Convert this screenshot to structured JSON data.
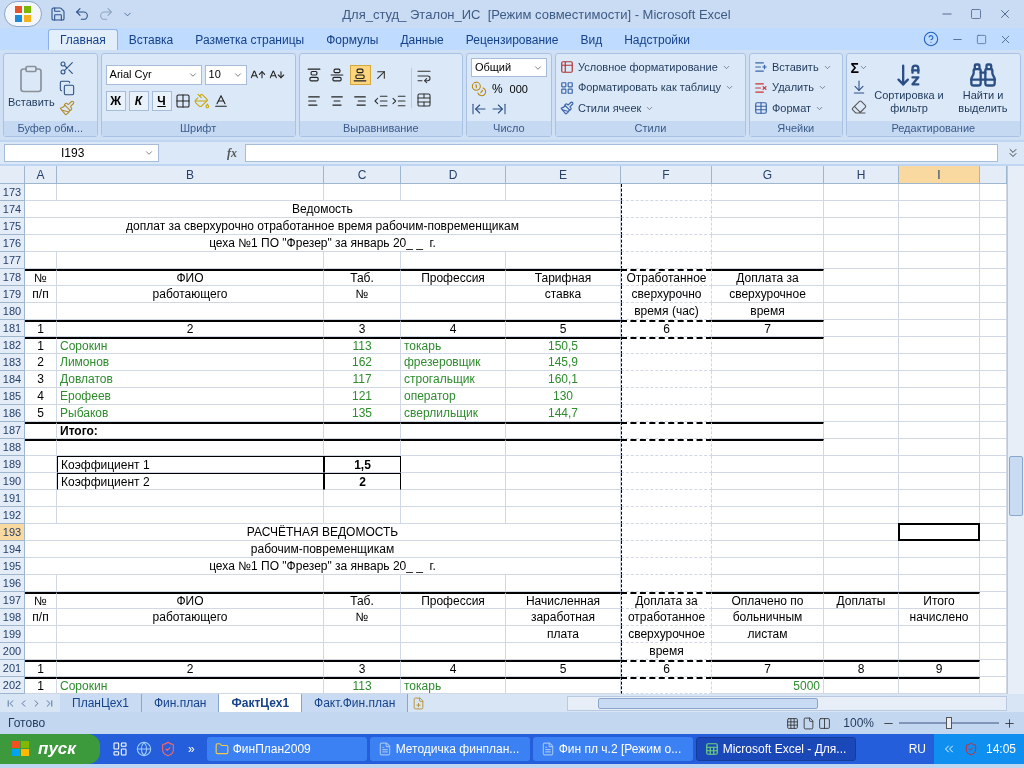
{
  "window": {
    "title": "Для_студ_ Эталон_ИС  [Режим совместимости] - Microsoft Excel"
  },
  "ribbon_tabs": [
    {
      "label": "Главная",
      "selected": true
    },
    {
      "label": "Вставка",
      "selected": false
    },
    {
      "label": "Разметка страницы",
      "selected": false
    },
    {
      "label": "Формулы",
      "selected": false
    },
    {
      "label": "Данные",
      "selected": false
    },
    {
      "label": "Рецензирование",
      "selected": false
    },
    {
      "label": "Вид",
      "selected": false
    },
    {
      "label": "Надстройки",
      "selected": false
    }
  ],
  "clipboard": {
    "paste": "Вставить",
    "label": "Буфер обм..."
  },
  "font": {
    "name": "Arial Cyr",
    "size": "10",
    "bold": "Ж",
    "italic": "К",
    "underline": "Ч",
    "label": "Шрифт"
  },
  "alignment": {
    "buttons": [
      {
        "kind": "top",
        "selected": false
      },
      {
        "kind": "middle",
        "selected": false
      },
      {
        "kind": "bottom",
        "selected": true
      },
      {
        "kind": "left",
        "selected": false
      },
      {
        "kind": "center",
        "selected": false
      },
      {
        "kind": "right",
        "selected": false
      }
    ],
    "label": "Выравнивание"
  },
  "number": {
    "format": "Общий",
    "percent": "%",
    "thousands": "000",
    "label": "Число"
  },
  "styles": {
    "items": [
      "Условное форматирование",
      "Форматировать как таблицу",
      "Стили ячеек"
    ],
    "label": "Стили"
  },
  "cells_group": {
    "items": [
      "Вставить",
      "Удалить",
      "Формат"
    ],
    "label": "Ячейки"
  },
  "editing": {
    "sum": "Σ",
    "sort": "Сортировка и фильтр",
    "find": "Найти и выделить",
    "label": "Редактирование"
  },
  "formula_bar": {
    "name_box": "I193",
    "fx": "fx"
  },
  "sheet": {
    "columns": [
      {
        "label": "A",
        "selected": false
      },
      {
        "label": "B",
        "selected": false
      },
      {
        "label": "C",
        "selected": false
      },
      {
        "label": "D",
        "selected": false
      },
      {
        "label": "E",
        "selected": false
      },
      {
        "label": "F",
        "selected": false
      },
      {
        "label": "G",
        "selected": false
      },
      {
        "label": "H",
        "selected": false
      },
      {
        "label": "I",
        "selected": true
      }
    ],
    "rows": [
      {
        "number": "173",
        "selected": false
      },
      {
        "number": "174",
        "selected": false,
        "kind": "title",
        "text": "Ведомость"
      },
      {
        "number": "175",
        "selected": false,
        "kind": "title",
        "text": "доплат за сверхурочно отработанное время рабочим-повременщикам"
      },
      {
        "number": "176",
        "selected": false,
        "kind": "title",
        "text": "цеха №1 ПО \"Фрезер\" за январь 20_ _  г."
      },
      {
        "number": "177",
        "selected": false
      },
      {
        "number": "178",
        "selected": false,
        "cells": [
          {
            "text": "№",
            "kind": "centered",
            "rule_above": true
          },
          {
            "text": "ФИО",
            "kind": "centered",
            "rule_above": true
          },
          {
            "text": "Таб.",
            "kind": "centered",
            "rule_above": true
          },
          {
            "text": "Профессия",
            "kind": "centered",
            "rule_above": true
          },
          {
            "text": "Тарифная",
            "kind": "centered",
            "rule_above": true
          },
          {
            "text": "Отработанное",
            "kind": "centered",
            "rule_above": true
          },
          {
            "text": "Доплата за",
            "kind": "centered",
            "rule_above": true
          }
        ]
      },
      {
        "number": "179",
        "selected": false,
        "cells": [
          {
            "text": "п/п",
            "kind": "centered"
          },
          {
            "text": "работающего",
            "kind": "centered"
          },
          {
            "text": "№",
            "kind": "centered"
          },
          null,
          {
            "text": "ставка",
            "kind": "centered"
          },
          {
            "text": "сверхурочно",
            "kind": "centered"
          },
          {
            "text": "сверхурочное",
            "kind": "centered"
          }
        ]
      },
      {
        "number": "180",
        "selected": false,
        "cells": [
          null,
          null,
          null,
          null,
          null,
          {
            "text": "время (час)",
            "kind": "centered"
          },
          {
            "text": "время",
            "kind": "centered"
          }
        ]
      },
      {
        "number": "181",
        "selected": false,
        "cells": [
          {
            "text": "1",
            "kind": "centered",
            "rule_above": true
          },
          {
            "text": "2",
            "kind": "centered",
            "rule_above": true
          },
          {
            "text": "3",
            "kind": "centered",
            "rule_above": true
          },
          {
            "text": "4",
            "kind": "centered",
            "rule_above": true
          },
          {
            "text": "5",
            "kind": "centered",
            "rule_above": true
          },
          {
            "text": "6",
            "kind": "centered",
            "rule_above": true
          },
          {
            "text": "7",
            "kind": "centered",
            "rule_above": true
          }
        ]
      },
      {
        "number": "182",
        "selected": false,
        "cells": [
          {
            "text": "1",
            "kind": "centered",
            "rule_above": true
          },
          {
            "text": "Сорокин",
            "kind": "left",
            "color": "#2e8b2e",
            "rule_above": true
          },
          {
            "text": "113",
            "kind": "centered",
            "color": "#2e8b2e",
            "rule_above": true
          },
          {
            "text": "токарь",
            "kind": "left",
            "color": "#2e8b2e",
            "rule_above": true
          },
          {
            "text": "150,5",
            "kind": "centered",
            "color": "#2e8b2e",
            "rule_above": true
          },
          {
            "rule_above": true
          },
          {
            "rule_above": true
          }
        ]
      },
      {
        "number": "183",
        "selected": false,
        "cells": [
          {
            "text": "2",
            "kind": "centered"
          },
          {
            "text": "Лимонов",
            "kind": "left",
            "color": "#2e8b2e"
          },
          {
            "text": "162",
            "kind": "centered",
            "color": "#2e8b2e"
          },
          {
            "text": "фрезеровщик",
            "kind": "left",
            "color": "#2e8b2e"
          },
          {
            "text": "145,9",
            "kind": "centered",
            "color": "#2e8b2e"
          }
        ]
      },
      {
        "number": "184",
        "selected": false,
        "cells": [
          {
            "text": "3",
            "kind": "centered"
          },
          {
            "text": "Довлатов",
            "kind": "left",
            "color": "#2e8b2e"
          },
          {
            "text": "117",
            "kind": "centered",
            "color": "#2e8b2e"
          },
          {
            "text": "строгальщик",
            "kind": "left",
            "color": "#2e8b2e"
          },
          {
            "text": "160,1",
            "kind": "centered",
            "color": "#2e8b2e"
          }
        ]
      },
      {
        "number": "185",
        "selected": false,
        "cells": [
          {
            "text": "4",
            "kind": "centered"
          },
          {
            "text": "Ерофеев",
            "kind": "left",
            "color": "#2e8b2e"
          },
          {
            "text": "121",
            "kind": "centered",
            "color": "#2e8b2e"
          },
          {
            "text": "оператор",
            "kind": "left",
            "color": "#2e8b2e"
          },
          {
            "text": "130",
            "kind": "centered",
            "color": "#2e8b2e"
          }
        ]
      },
      {
        "number": "186",
        "selected": false,
        "cells": [
          {
            "text": "5",
            "kind": "centered"
          },
          {
            "text": "Рыбаков",
            "kind": "left",
            "color": "#2e8b2e"
          },
          {
            "text": "135",
            "kind": "centered",
            "color": "#2e8b2e"
          },
          {
            "text": "сверлильщик",
            "kind": "left",
            "color": "#2e8b2e"
          },
          {
            "text": "144,7",
            "kind": "centered",
            "color": "#2e8b2e"
          }
        ]
      },
      {
        "number": "187",
        "selected": false,
        "cells": [
          {
            "rule_above": true
          },
          {
            "text": "Итого:",
            "kind": "left",
            "bold": true,
            "rule_above": true
          },
          {
            "rule_above": true
          },
          {
            "rule_above": true
          },
          {
            "rule_above": true
          },
          {
            "rule_above": true
          },
          {
            "rule_above": true
          }
        ]
      },
      {
        "number": "188",
        "selected": false,
        "cells": [
          {
            "rule_above": true
          },
          {
            "rule_above": true
          },
          {
            "rule_above": true
          },
          {
            "rule_above": true
          },
          {
            "rule_above": true
          },
          {
            "rule_above": true
          },
          {
            "rule_above": true
          }
        ]
      },
      {
        "number": "189",
        "selected": false,
        "cells": [
          null,
          {
            "text": "Коэффициент 1",
            "kind": "left",
            "boxed": true
          },
          {
            "text": "1,5",
            "kind": "centered",
            "bold": true,
            "boxed": true
          }
        ]
      },
      {
        "number": "190",
        "selected": false,
        "cells": [
          null,
          {
            "text": "Коэффициент 2",
            "kind": "left",
            "boxed": true
          },
          {
            "text": "2",
            "kind": "centered",
            "bold": true,
            "boxed": true
          }
        ]
      },
      {
        "number": "191",
        "selected": false
      },
      {
        "number": "192",
        "selected": false
      },
      {
        "number": "193",
        "selected": true,
        "kind": "title",
        "text": "РАСЧЁТНАЯ ВЕДОМОСТЬ"
      },
      {
        "number": "194",
        "selected": false,
        "kind": "title",
        "text": "рабочим-повременщикам"
      },
      {
        "number": "195",
        "selected": false,
        "kind": "title",
        "text": "цеха №1 ПО \"Фрезер\" за январь 20_ _  г."
      },
      {
        "number": "196",
        "selected": false
      },
      {
        "number": "197",
        "selected": false,
        "cells": [
          {
            "text": "№",
            "kind": "centered",
            "rule_above": true
          },
          {
            "text": "ФИО",
            "kind": "centered",
            "rule_above": true
          },
          {
            "text": "Таб.",
            "kind": "centered",
            "rule_above": true
          },
          {
            "text": "Профессия",
            "kind": "centered",
            "rule_above": true
          },
          {
            "text": "Начисленная",
            "kind": "centered",
            "rule_above": true
          },
          {
            "text": "Доплата за",
            "kind": "centered",
            "rule_above": true
          },
          {
            "text": "Оплачено по",
            "kind": "centered",
            "rule_above": true
          },
          {
            "text": "Доплаты",
            "kind": "centered",
            "rule_above": true
          },
          {
            "text": "Итого",
            "kind": "centered",
            "rule_above": true
          }
        ]
      },
      {
        "number": "198",
        "selected": false,
        "cells": [
          {
            "text": "п/п",
            "kind": "centered"
          },
          {
            "text": "работающего",
            "kind": "centered"
          },
          {
            "text": "№",
            "kind": "centered"
          },
          null,
          {
            "text": "заработная",
            "kind": "centered"
          },
          {
            "text": "отработанное",
            "kind": "centered"
          },
          {
            "text": "больничным",
            "kind": "centered"
          },
          null,
          {
            "text": "начислено",
            "kind": "centered"
          }
        ]
      },
      {
        "number": "199",
        "selected": false,
        "cells": [
          null,
          null,
          null,
          null,
          {
            "text": "плата",
            "kind": "centered"
          },
          {
            "text": "сверхурочное",
            "kind": "centered"
          },
          {
            "text": "листам",
            "kind": "centered"
          }
        ]
      },
      {
        "number": "200",
        "selected": false,
        "cells": [
          null,
          null,
          null,
          null,
          null,
          {
            "text": "время",
            "kind": "centered"
          }
        ]
      },
      {
        "number": "201",
        "selected": false,
        "cells": [
          {
            "text": "1",
            "kind": "centered",
            "rule_above": true
          },
          {
            "text": "2",
            "kind": "centered",
            "rule_above": true
          },
          {
            "text": "3",
            "kind": "centered",
            "rule_above": true
          },
          {
            "text": "4",
            "kind": "centered",
            "rule_above": true
          },
          {
            "text": "5",
            "kind": "centered",
            "rule_above": true
          },
          {
            "text": "6",
            "kind": "centered",
            "rule_above": true
          },
          {
            "text": "7",
            "kind": "centered",
            "rule_above": true
          },
          {
            "text": "8",
            "kind": "centered",
            "rule_above": true
          },
          {
            "text": "9",
            "kind": "centered",
            "rule_above": true
          }
        ]
      },
      {
        "number": "202",
        "selected": false,
        "cells": [
          {
            "text": "1",
            "kind": "centered",
            "rule_above": true
          },
          {
            "text": "Сорокин",
            "kind": "left",
            "color": "#2e8b2e",
            "rule_above": true
          },
          {
            "text": "113",
            "kind": "centered",
            "color": "#2e8b2e",
            "rule_above": true
          },
          {
            "text": "токарь",
            "kind": "left",
            "color": "#2e8b2e",
            "rule_above": true
          },
          {
            "rule_above": true
          },
          {
            "rule_above": true
          },
          {
            "text": "5000",
            "kind": "right",
            "color": "#2e8b2e",
            "rule_above": true
          },
          {
            "rule_above": true
          },
          {
            "rule_above": true
          }
        ]
      }
    ]
  },
  "sheet_tabs": [
    {
      "label": "ПланЦех1",
      "selected": false
    },
    {
      "label": "Фин.план",
      "selected": false
    },
    {
      "label": "ФактЦех1",
      "selected": true
    },
    {
      "label": "Факт.Фин.план",
      "selected": false
    }
  ],
  "status_bar": {
    "text": "Готово",
    "zoom": "100%",
    "zoom_slider": {
      "level": 0.5
    }
  },
  "taskbar": {
    "start": "пуск",
    "more": "»",
    "items": [
      {
        "label": "ФинПлан2009",
        "kind": "folder",
        "selected": false
      },
      {
        "label": "Методичка финплан...",
        "kind": "word",
        "selected": false
      },
      {
        "label": "Фин пл ч.2 [Режим о...",
        "kind": "word",
        "selected": false
      },
      {
        "label": "Microsoft Excel - Для...",
        "kind": "excel",
        "selected": true
      }
    ],
    "language": "RU",
    "clock": "14:05"
  }
}
